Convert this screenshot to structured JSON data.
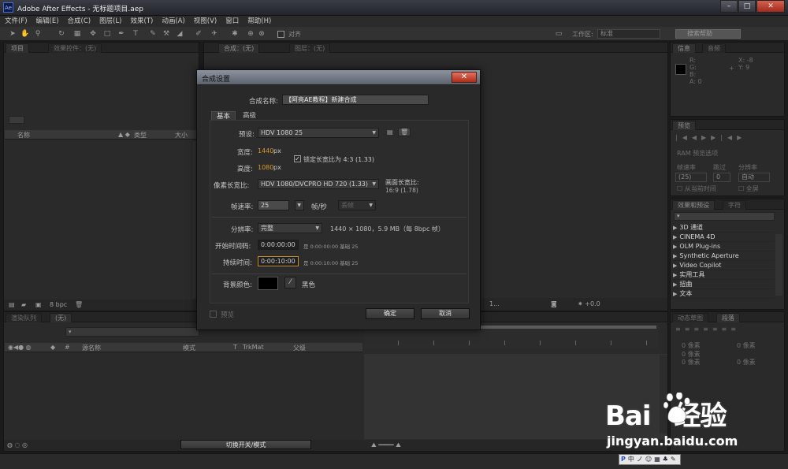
{
  "window": {
    "logo": "Ae",
    "title": "Adobe After Effects - 无标题项目.aep",
    "buttons": [
      "–",
      "□",
      "✕"
    ]
  },
  "menu": [
    "文件(F)",
    "编辑(E)",
    "合成(C)",
    "图层(L)",
    "效果(T)",
    "动画(A)",
    "视图(V)",
    "窗口",
    "帮助(H)"
  ],
  "toolbar": {
    "align_label": "对齐",
    "workspace_label": "工作区:",
    "workspace_value": "标准",
    "search_placeholder": "搜索帮助"
  },
  "project_panel": {
    "tabs": [
      "项目",
      "效果控件：(无)"
    ],
    "columns": {
      "name": "名称",
      "type": "类型",
      "size": "大小"
    },
    "bpc": "8 bpc"
  },
  "comp_panel": {
    "tabs": [
      "合成：(无)",
      "图层：(无)"
    ]
  },
  "info_panel": {
    "tabs": [
      "信息",
      "音频"
    ],
    "r": "R:",
    "g": "G:",
    "b": "B:",
    "a": "A: 0",
    "x": "X: -8",
    "y": "Y: 9"
  },
  "preview_panel": {
    "tab": "预览",
    "ram_options": "RAM 预览选项",
    "frame_rate": "帧速率",
    "skip": "跳过",
    "resolution": "分辨率",
    "frame_rate_value": "(25)",
    "skip_value": "0",
    "resolution_value": "自动",
    "from_current": "从当前时间",
    "fullscreen": "全屏"
  },
  "effects_panel": {
    "tabs": [
      "效果和预设",
      "字符"
    ],
    "items": [
      "3D 通道",
      "CINEMA 4D",
      "OLM Plug-ins",
      "Synthetic Aperture",
      "Video Copilot",
      "实用工具",
      "扭曲",
      "文本"
    ]
  },
  "paragraph_panel": {
    "tabs": [
      "动态草图",
      "段落"
    ],
    "px_rows": [
      "0 像素",
      "0 像素",
      "0 像素",
      "0 像素",
      "0 像素"
    ]
  },
  "timeline": {
    "tabs": [
      "渲染队列",
      "(无)"
    ],
    "columns": {
      "hash": "#",
      "source": "源名称",
      "mode": "模式",
      "t": "T",
      "trkmat": "TrkMat",
      "parent": "父级"
    },
    "toggle_label": "切换开关/模式"
  },
  "dialog": {
    "title": "合成设置",
    "close": "✕",
    "name_label": "合成名称:",
    "name_value": "【阿亮AE教程】新建合成",
    "tabs": [
      "基本",
      "高级"
    ],
    "preset_label": "预设:",
    "preset_value": "HDV 1080 25",
    "width_label": "宽度:",
    "width_value": "1440",
    "width_unit": "px",
    "height_label": "高度:",
    "height_value": "1080",
    "height_unit": "px",
    "lock_label": "锁定长宽比为 4:3 (1.33)",
    "par_label": "像素长宽比:",
    "par_value": "HDV 1080/DVCPRO HD 720 (1.33)",
    "frame_aspect_label": "画面长宽比:",
    "frame_aspect_value": "16:9 (1.78)",
    "fps_label": "帧速率:",
    "fps_value": "25",
    "fps_unit": "帧/秒",
    "drop_frame": "丢帧",
    "res_label": "分辨率:",
    "res_value": "完整",
    "res_info": "1440 × 1080，5.9 MB（每 8bpc 帧）",
    "start_label": "开始时间码:",
    "start_value": "0:00:00:00",
    "start_info": "是 0:00:00:00  基础 25",
    "duration_label": "持续时间:",
    "duration_value": "0:00:10:00",
    "duration_info": "是 0:00:10:00  基础 25",
    "bg_label": "背景颜色:",
    "bg_color_name": "黑色",
    "bg_color": "#000000",
    "preview_label": "预览",
    "ok": "确定",
    "cancel": "取消"
  },
  "watermark": {
    "main_a": "Bai",
    "main_b": "经验",
    "sub": "jingyan.baidu.com"
  },
  "ime": [
    "中",
    "ノ",
    "☺",
    "▦",
    "♣",
    "✎"
  ]
}
